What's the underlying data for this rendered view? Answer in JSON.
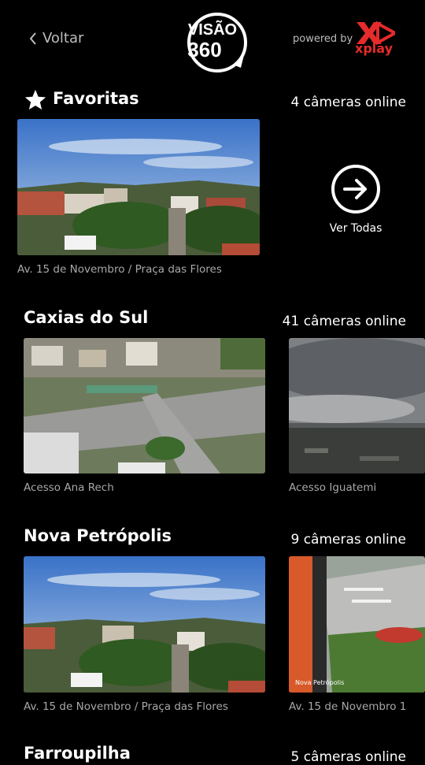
{
  "header": {
    "back_label": "Voltar",
    "logo_text": "VISÃO 360",
    "powered_by": "powered by",
    "partner_logo_text": "xplay"
  },
  "favorites": {
    "title": "Favoritas",
    "count_label": "4 câmeras online",
    "see_all_label": "Ver Todas",
    "cameras": [
      {
        "caption": "Av. 15 de Novembro / Praça das Flores"
      }
    ]
  },
  "caxias": {
    "title": "Caxias do Sul",
    "count_label": "41 câmeras online",
    "cameras": [
      {
        "caption": "Acesso Ana Rech"
      },
      {
        "caption": "Acesso Iguatemi"
      }
    ]
  },
  "nova_petropolis": {
    "title": "Nova Petrópolis",
    "count_label": "9 câmeras online",
    "cameras": [
      {
        "caption": "Av. 15 de Novembro / Praça das Flores"
      },
      {
        "caption": "Av. 15 de Novembro 1",
        "overlay": "Nova Petrópolis"
      }
    ]
  },
  "farroupilha": {
    "title": "Farroupilha",
    "count_label": "5 câmeras online"
  },
  "colors": {
    "background": "#000000",
    "text": "#ffffff",
    "caption": "#a8a8a8",
    "brand_red": "#e52b2b"
  }
}
